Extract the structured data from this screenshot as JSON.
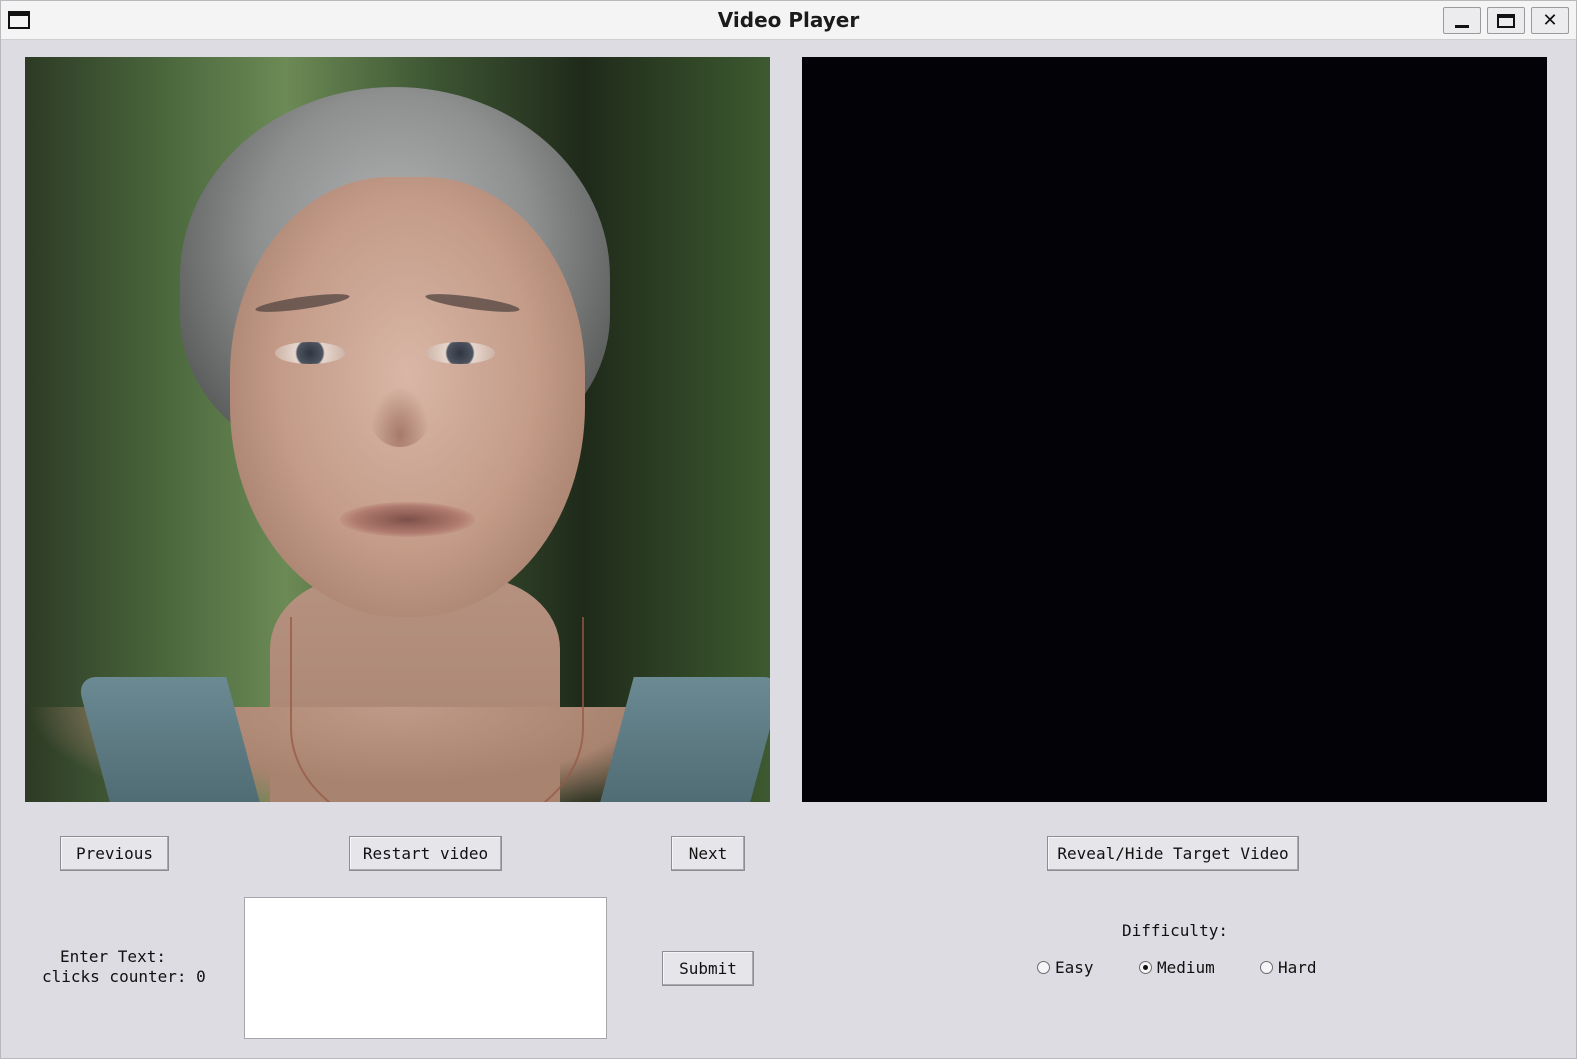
{
  "window": {
    "title": "Video Player",
    "icon": "window-icon",
    "controls": {
      "minimize": "minimize-icon",
      "maximize": "maximize-icon",
      "close": "close-icon"
    }
  },
  "videos": {
    "left": {
      "state": "playing",
      "content": "portrait-frame"
    },
    "right": {
      "state": "hidden",
      "background": "#030207"
    }
  },
  "controls": {
    "previous_label": "Previous",
    "restart_label": "Restart video",
    "next_label": "Next",
    "reveal_label": "Reveal/Hide Target Video",
    "submit_label": "Submit"
  },
  "input": {
    "enter_text_label": "Enter Text:",
    "clicks_counter_label": "clicks counter: 0",
    "value": ""
  },
  "difficulty": {
    "label": "Difficulty:",
    "options": [
      {
        "label": "Easy",
        "selected": false
      },
      {
        "label": "Medium",
        "selected": true
      },
      {
        "label": "Hard",
        "selected": false
      }
    ]
  }
}
